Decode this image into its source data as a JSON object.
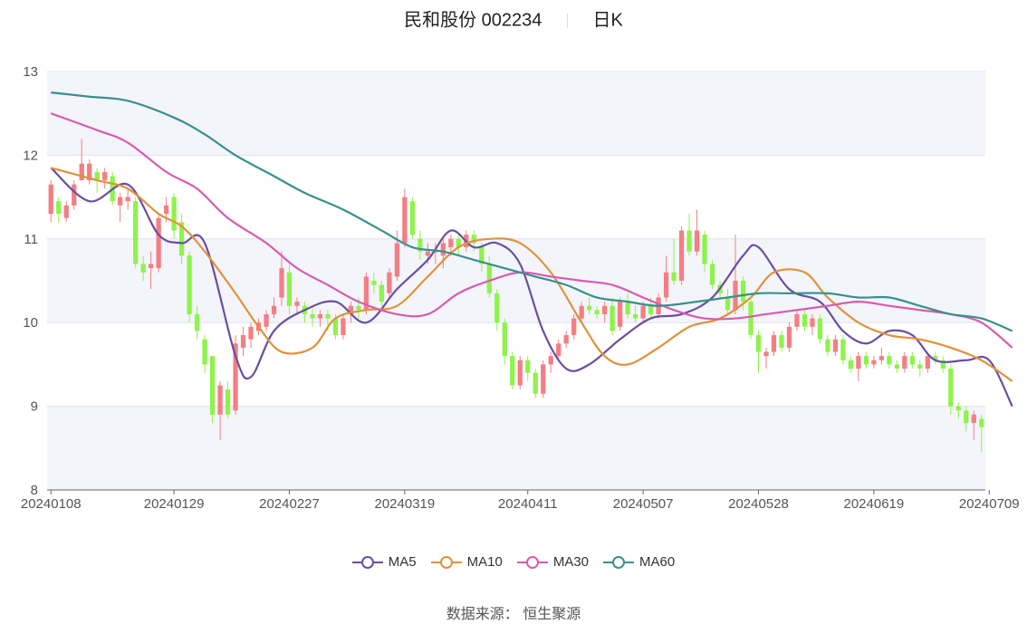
{
  "header": {
    "stock_name": "民和股份",
    "stock_code": "002234",
    "period": "日K"
  },
  "source": {
    "label": "数据来源：",
    "value": "恒生聚源"
  },
  "colors": {
    "up": "#f47e84",
    "down": "#8ef34a",
    "MA5": "#6a4ea3",
    "MA10": "#e0923a",
    "MA30": "#d95aaf",
    "MA60": "#38908c",
    "band": "#f4f5fb",
    "grid": "#dfe3ef"
  },
  "chart_data": {
    "type": "candlestick",
    "title": "民和股份 002234 日K",
    "ylim": [
      8,
      13
    ],
    "yticks": [
      8,
      9,
      10,
      11,
      12,
      13
    ],
    "xtick_labels": [
      "20240108",
      "20240129",
      "20240227",
      "20240319",
      "20240411",
      "20240507",
      "20240528",
      "20240619",
      "20240709"
    ],
    "xtick_index": [
      0,
      16,
      31,
      46,
      62,
      77,
      92,
      107,
      122
    ],
    "legend": [
      "MA5",
      "MA10",
      "MA30",
      "MA60"
    ],
    "candles": [
      [
        11.3,
        11.65,
        11.7,
        11.2
      ],
      [
        11.45,
        11.3,
        11.5,
        11.2
      ],
      [
        11.25,
        11.4,
        11.45,
        11.2
      ],
      [
        11.4,
        11.65,
        11.7,
        11.35
      ],
      [
        11.7,
        11.9,
        12.2,
        11.7
      ],
      [
        11.7,
        11.9,
        11.95,
        11.65
      ],
      [
        11.8,
        11.7,
        11.85,
        11.55
      ],
      [
        11.7,
        11.8,
        11.85,
        11.6
      ],
      [
        11.75,
        11.45,
        11.8,
        11.4
      ],
      [
        11.4,
        11.5,
        11.55,
        11.2
      ],
      [
        11.45,
        11.5,
        11.6,
        11.35
      ],
      [
        11.45,
        10.7,
        11.5,
        10.65
      ],
      [
        10.7,
        10.6,
        10.8,
        10.5
      ],
      [
        10.65,
        10.7,
        10.85,
        10.4
      ],
      [
        10.65,
        11.25,
        11.3,
        10.6
      ],
      [
        11.3,
        11.4,
        11.5,
        11.2
      ],
      [
        11.5,
        11.1,
        11.55,
        11.0
      ],
      [
        11.2,
        10.8,
        11.3,
        10.7
      ],
      [
        10.8,
        10.1,
        10.85,
        10.0
      ],
      [
        10.1,
        9.9,
        10.2,
        9.8
      ],
      [
        9.8,
        9.5,
        9.85,
        9.4
      ],
      [
        9.6,
        8.9,
        9.6,
        8.8
      ],
      [
        8.9,
        9.25,
        9.3,
        8.6
      ],
      [
        9.2,
        8.9,
        9.3,
        8.85
      ],
      [
        8.95,
        9.75,
        9.85,
        8.9
      ],
      [
        9.7,
        9.85,
        9.95,
        9.6
      ],
      [
        9.8,
        9.95,
        10.0,
        9.7
      ],
      [
        9.9,
        10.0,
        10.05,
        9.85
      ],
      [
        9.95,
        10.1,
        10.15,
        9.9
      ],
      [
        10.1,
        10.2,
        10.3,
        10.05
      ],
      [
        10.3,
        10.65,
        10.85,
        10.2
      ],
      [
        10.6,
        10.2,
        10.7,
        10.1
      ],
      [
        10.2,
        10.25,
        10.3,
        10.1
      ],
      [
        10.2,
        10.1,
        10.25,
        10.0
      ],
      [
        10.1,
        10.05,
        10.2,
        9.95
      ],
      [
        10.05,
        10.1,
        10.15,
        9.95
      ],
      [
        10.1,
        10.05,
        10.15,
        9.9
      ],
      [
        10.05,
        9.85,
        10.1,
        9.8
      ],
      [
        9.85,
        10.05,
        10.1,
        9.8
      ],
      [
        10.1,
        10.2,
        10.25,
        10.0
      ],
      [
        10.2,
        10.15,
        10.3,
        10.05
      ],
      [
        10.15,
        10.55,
        10.6,
        10.1
      ],
      [
        10.5,
        10.45,
        10.6,
        10.35
      ],
      [
        10.45,
        10.25,
        10.5,
        10.2
      ],
      [
        10.35,
        10.6,
        10.65,
        10.3
      ],
      [
        10.55,
        10.95,
        11.1,
        10.5
      ],
      [
        10.95,
        11.5,
        11.6,
        10.9
      ],
      [
        11.45,
        11.05,
        11.5,
        11.0
      ],
      [
        11.0,
        10.85,
        11.1,
        10.75
      ],
      [
        10.8,
        10.85,
        10.95,
        10.7
      ],
      [
        10.85,
        10.85,
        10.95,
        10.7
      ],
      [
        10.8,
        10.95,
        11.0,
        10.65
      ],
      [
        10.9,
        11.0,
        11.05,
        10.8
      ],
      [
        11.0,
        10.9,
        11.05,
        10.8
      ],
      [
        10.9,
        11.05,
        11.1,
        10.85
      ],
      [
        11.05,
        10.95,
        11.1,
        10.85
      ],
      [
        10.9,
        10.7,
        10.95,
        10.6
      ],
      [
        10.7,
        10.35,
        10.8,
        10.3
      ],
      [
        10.35,
        10.0,
        10.4,
        9.9
      ],
      [
        10.0,
        9.6,
        10.05,
        9.5
      ],
      [
        9.6,
        9.25,
        9.65,
        9.2
      ],
      [
        9.25,
        9.55,
        9.6,
        9.2
      ],
      [
        9.55,
        9.4,
        9.6,
        9.3
      ],
      [
        9.4,
        9.15,
        9.45,
        9.1
      ],
      [
        9.15,
        9.5,
        9.55,
        9.1
      ],
      [
        9.5,
        9.6,
        9.65,
        9.4
      ],
      [
        9.6,
        9.75,
        9.8,
        9.55
      ],
      [
        9.75,
        9.85,
        9.9,
        9.7
      ],
      [
        9.85,
        10.05,
        10.1,
        9.8
      ],
      [
        10.05,
        10.2,
        10.25,
        10.0
      ],
      [
        10.2,
        10.15,
        10.3,
        10.1
      ],
      [
        10.15,
        10.1,
        10.2,
        10.05
      ],
      [
        10.1,
        10.2,
        10.25,
        10.0
      ],
      [
        10.2,
        9.9,
        10.3,
        9.85
      ],
      [
        9.95,
        10.25,
        10.3,
        9.9
      ],
      [
        10.25,
        10.1,
        10.35,
        10.05
      ],
      [
        10.1,
        10.05,
        10.2,
        10.0
      ],
      [
        10.05,
        10.2,
        10.25,
        10.0
      ],
      [
        10.2,
        10.1,
        10.3,
        10.05
      ],
      [
        10.1,
        10.3,
        10.35,
        10.05
      ],
      [
        10.3,
        10.6,
        10.8,
        10.25
      ],
      [
        10.6,
        10.5,
        11.0,
        10.45
      ],
      [
        10.5,
        11.1,
        11.15,
        10.45
      ],
      [
        11.1,
        10.85,
        11.3,
        10.8
      ],
      [
        10.85,
        11.1,
        11.35,
        10.8
      ],
      [
        11.05,
        10.7,
        11.1,
        10.6
      ],
      [
        10.7,
        10.45,
        10.75,
        10.4
      ],
      [
        10.45,
        10.35,
        10.5,
        10.3
      ],
      [
        10.3,
        10.15,
        10.4,
        10.1
      ],
      [
        10.15,
        10.5,
        11.05,
        10.1
      ],
      [
        10.5,
        10.25,
        10.55,
        10.15
      ],
      [
        10.25,
        9.85,
        10.3,
        9.8
      ],
      [
        9.85,
        9.65,
        9.9,
        9.4
      ],
      [
        9.6,
        9.65,
        9.7,
        9.45
      ],
      [
        9.65,
        9.85,
        9.9,
        9.6
      ],
      [
        9.85,
        9.7,
        9.9,
        9.65
      ],
      [
        9.7,
        9.95,
        10.0,
        9.65
      ],
      [
        9.95,
        10.1,
        10.15,
        9.9
      ],
      [
        10.1,
        9.95,
        10.15,
        9.9
      ],
      [
        9.95,
        10.05,
        10.1,
        9.85
      ],
      [
        10.05,
        9.8,
        10.1,
        9.75
      ],
      [
        9.8,
        9.65,
        9.85,
        9.6
      ],
      [
        9.65,
        9.8,
        9.85,
        9.6
      ],
      [
        9.8,
        9.55,
        9.85,
        9.5
      ],
      [
        9.55,
        9.45,
        9.6,
        9.4
      ],
      [
        9.45,
        9.6,
        9.65,
        9.3
      ],
      [
        9.6,
        9.5,
        9.65,
        9.45
      ],
      [
        9.5,
        9.55,
        9.6,
        9.45
      ],
      [
        9.55,
        9.6,
        9.7,
        9.5
      ],
      [
        9.6,
        9.5,
        9.65,
        9.45
      ],
      [
        9.5,
        9.45,
        9.55,
        9.4
      ],
      [
        9.45,
        9.6,
        9.65,
        9.4
      ],
      [
        9.6,
        9.5,
        9.65,
        9.45
      ],
      [
        9.5,
        9.45,
        9.55,
        9.35
      ],
      [
        9.45,
        9.6,
        9.65,
        9.4
      ],
      [
        9.6,
        9.55,
        9.65,
        9.5
      ],
      [
        9.55,
        9.45,
        9.6,
        9.4
      ],
      [
        9.45,
        9.0,
        9.5,
        8.9
      ],
      [
        9.0,
        8.95,
        9.05,
        8.85
      ],
      [
        8.95,
        8.8,
        9.0,
        8.7
      ],
      [
        8.8,
        8.9,
        8.95,
        8.6
      ],
      [
        8.85,
        8.75,
        8.9,
        8.45
      ]
    ],
    "series": [
      {
        "name": "MA5",
        "points": [
          [
            0,
            11.85
          ],
          [
            5,
            11.45
          ],
          [
            10,
            11.65
          ],
          [
            14,
            11.05
          ],
          [
            17,
            10.95
          ],
          [
            20,
            10.95
          ],
          [
            24,
            9.6
          ],
          [
            26,
            9.35
          ],
          [
            29,
            9.9
          ],
          [
            33,
            10.15
          ],
          [
            37,
            10.25
          ],
          [
            41,
            10.0
          ],
          [
            45,
            10.4
          ],
          [
            49,
            10.75
          ],
          [
            52,
            11.1
          ],
          [
            55,
            10.9
          ],
          [
            58,
            10.95
          ],
          [
            61,
            10.7
          ],
          [
            64,
            9.9
          ],
          [
            67,
            9.45
          ],
          [
            70,
            9.5
          ],
          [
            74,
            9.8
          ],
          [
            78,
            10.05
          ],
          [
            82,
            10.1
          ],
          [
            86,
            10.3
          ],
          [
            90,
            10.8
          ],
          [
            92,
            10.9
          ],
          [
            96,
            10.4
          ],
          [
            100,
            10.25
          ],
          [
            103,
            9.9
          ],
          [
            106,
            9.75
          ],
          [
            109,
            9.9
          ],
          [
            112,
            9.85
          ],
          [
            115,
            9.55
          ],
          [
            119,
            9.55
          ],
          [
            122,
            9.55
          ],
          [
            125,
            9.0
          ]
        ]
      },
      {
        "name": "MA10",
        "points": [
          [
            0,
            11.85
          ],
          [
            6,
            11.7
          ],
          [
            10,
            11.6
          ],
          [
            14,
            11.3
          ],
          [
            17,
            11.15
          ],
          [
            20,
            10.85
          ],
          [
            24,
            10.35
          ],
          [
            27,
            9.95
          ],
          [
            30,
            9.65
          ],
          [
            34,
            9.7
          ],
          [
            37,
            10.05
          ],
          [
            41,
            10.15
          ],
          [
            45,
            10.2
          ],
          [
            49,
            10.55
          ],
          [
            53,
            10.9
          ],
          [
            57,
            11.0
          ],
          [
            61,
            10.95
          ],
          [
            65,
            10.6
          ],
          [
            69,
            10.0
          ],
          [
            72,
            9.6
          ],
          [
            75,
            9.5
          ],
          [
            79,
            9.7
          ],
          [
            83,
            9.95
          ],
          [
            87,
            10.05
          ],
          [
            91,
            10.3
          ],
          [
            94,
            10.6
          ],
          [
            98,
            10.6
          ],
          [
            101,
            10.3
          ],
          [
            105,
            10.0
          ],
          [
            109,
            9.85
          ],
          [
            113,
            9.8
          ],
          [
            117,
            9.7
          ],
          [
            121,
            9.55
          ],
          [
            125,
            9.3
          ]
        ]
      },
      {
        "name": "MA30",
        "points": [
          [
            0,
            12.5
          ],
          [
            6,
            12.3
          ],
          [
            10,
            12.15
          ],
          [
            15,
            11.8
          ],
          [
            19,
            11.6
          ],
          [
            23,
            11.25
          ],
          [
            28,
            10.95
          ],
          [
            32,
            10.65
          ],
          [
            36,
            10.45
          ],
          [
            40,
            10.25
          ],
          [
            45,
            10.1
          ],
          [
            49,
            10.1
          ],
          [
            53,
            10.35
          ],
          [
            57,
            10.5
          ],
          [
            61,
            10.6
          ],
          [
            65,
            10.55
          ],
          [
            69,
            10.5
          ],
          [
            73,
            10.45
          ],
          [
            77,
            10.3
          ],
          [
            81,
            10.15
          ],
          [
            85,
            10.05
          ],
          [
            89,
            10.05
          ],
          [
            93,
            10.1
          ],
          [
            97,
            10.15
          ],
          [
            101,
            10.2
          ],
          [
            105,
            10.25
          ],
          [
            109,
            10.2
          ],
          [
            113,
            10.15
          ],
          [
            117,
            10.1
          ],
          [
            121,
            10.0
          ],
          [
            125,
            9.7
          ]
        ]
      },
      {
        "name": "MA60",
        "points": [
          [
            0,
            12.75
          ],
          [
            5,
            12.7
          ],
          [
            10,
            12.65
          ],
          [
            16,
            12.45
          ],
          [
            20,
            12.25
          ],
          [
            24,
            12.0
          ],
          [
            29,
            11.75
          ],
          [
            33,
            11.55
          ],
          [
            38,
            11.35
          ],
          [
            43,
            11.1
          ],
          [
            47,
            10.9
          ],
          [
            51,
            10.85
          ],
          [
            55,
            10.75
          ],
          [
            59,
            10.65
          ],
          [
            63,
            10.55
          ],
          [
            67,
            10.45
          ],
          [
            71,
            10.3
          ],
          [
            75,
            10.25
          ],
          [
            79,
            10.2
          ],
          [
            84,
            10.25
          ],
          [
            88,
            10.3
          ],
          [
            92,
            10.35
          ],
          [
            96,
            10.35
          ],
          [
            101,
            10.35
          ],
          [
            105,
            10.3
          ],
          [
            109,
            10.3
          ],
          [
            113,
            10.2
          ],
          [
            117,
            10.1
          ],
          [
            121,
            10.05
          ],
          [
            125,
            9.9
          ]
        ]
      }
    ]
  }
}
